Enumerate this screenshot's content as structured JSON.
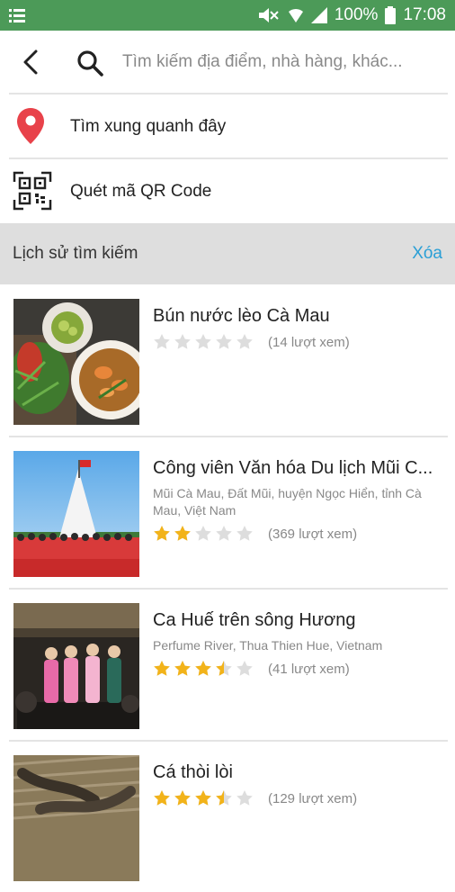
{
  "status_bar": {
    "battery": "100%",
    "time": "17:08"
  },
  "search": {
    "placeholder": "Tìm kiếm địa điểm, nhà hàng, khác..."
  },
  "menu": {
    "nearby_label": "Tìm xung quanh đây",
    "qr_label": "Quét mã QR Code"
  },
  "history": {
    "title": "Lịch sử tìm kiếm",
    "clear_label": "Xóa"
  },
  "results": [
    {
      "title": "Bún nước lèo Cà Mau",
      "address": "",
      "rating": 0,
      "views": "(14 lượt xem)"
    },
    {
      "title": "Công viên Văn hóa Du lịch Mũi C...",
      "address": "Mũi Cà Mau, Đất Mũi, huyện Ngọc Hiển, tỉnh Cà Mau, Việt Nam",
      "rating": 2,
      "views": "(369 lượt xem)"
    },
    {
      "title": "Ca Huế trên sông Hương",
      "address": "Perfume River, Thua Thien Hue, Vietnam",
      "rating": 3.5,
      "views": "(41 lượt xem)"
    },
    {
      "title": "Cá thòi lòi",
      "address": "",
      "rating": 3.5,
      "views": "(129 lượt xem)"
    }
  ],
  "colors": {
    "status_bar": "#4c9a58",
    "accent": "#2a9fd6",
    "star_filled": "#f2b31a",
    "star_empty": "#dddddd",
    "pin": "#e8424a"
  }
}
